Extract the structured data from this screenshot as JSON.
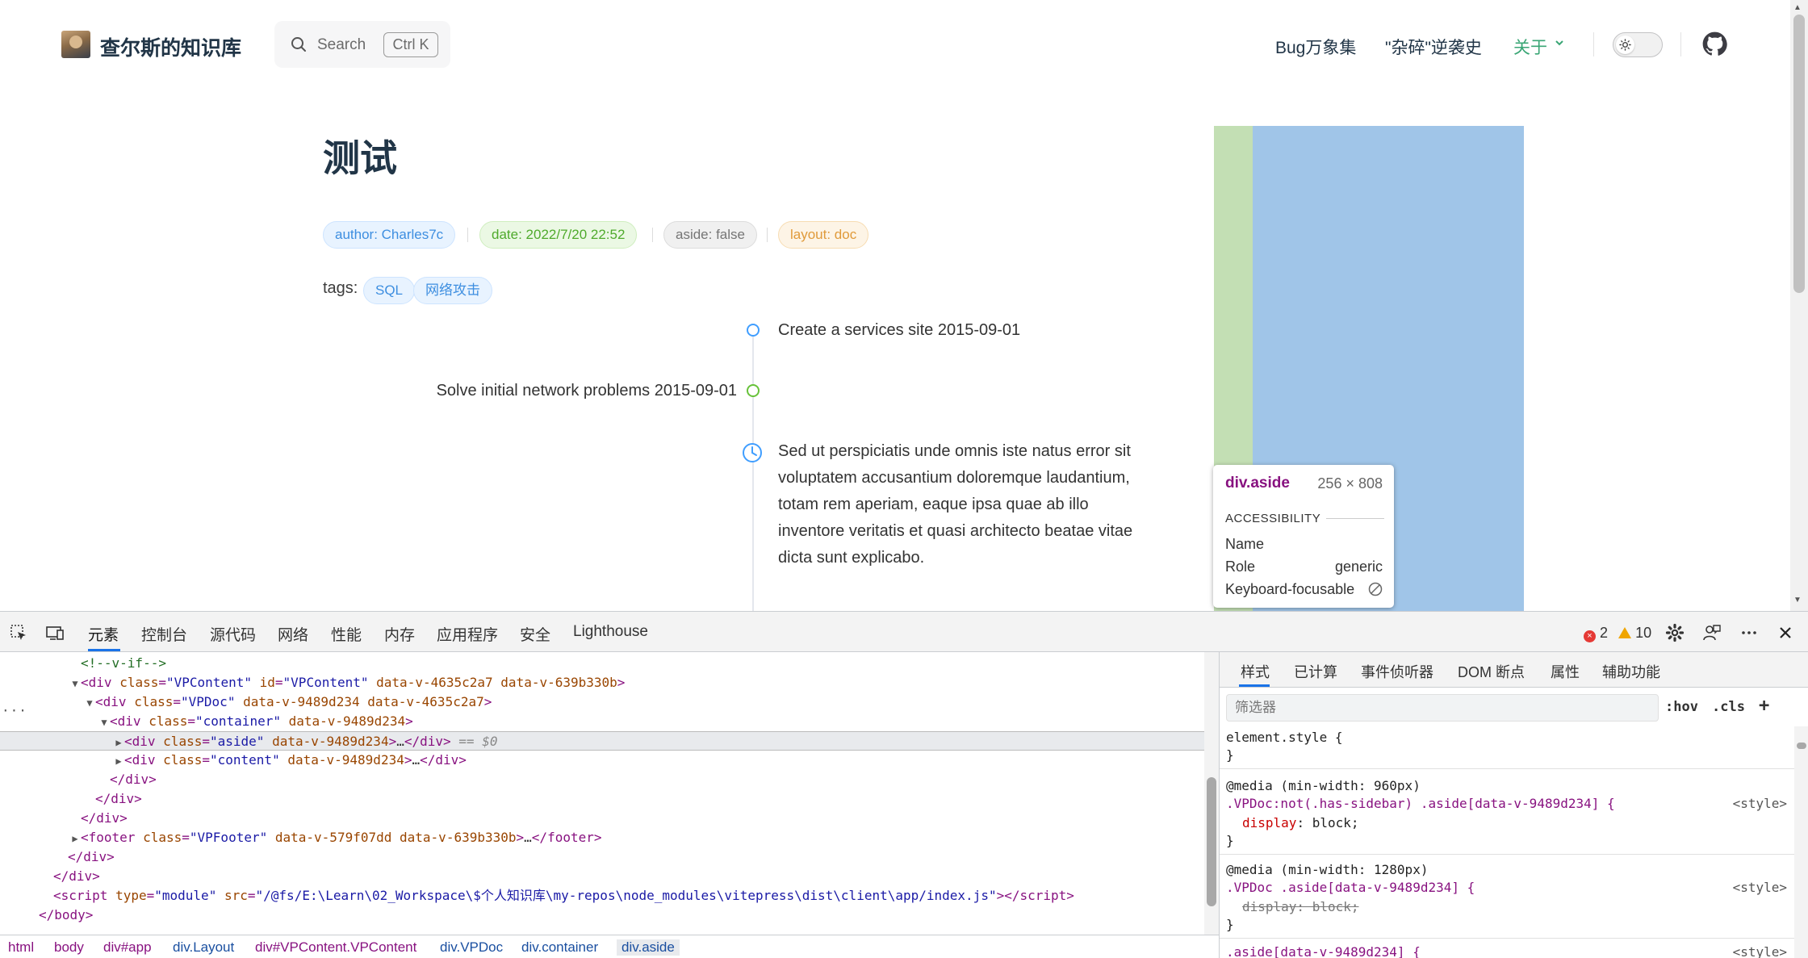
{
  "nav": {
    "site_title": "查尔斯的知识库",
    "search_label": "Search",
    "search_kbd": "Ctrl K",
    "links": [
      {
        "label": "Bug万象集"
      },
      {
        "label": "\"杂碎\"逆袭史"
      },
      {
        "label": "关于"
      }
    ]
  },
  "doc": {
    "title": "测试",
    "badges": {
      "author": "author: Charles7c",
      "date": "date: 2022/7/20 22:52",
      "aside": "aside: false",
      "layout": "layout: doc"
    },
    "tags_label": "tags:",
    "tags": [
      "SQL",
      "网络攻击"
    ],
    "timeline": [
      {
        "text": "Create a services site 2015-09-01"
      },
      {
        "text": "Solve initial network problems 2015-09-01"
      },
      {
        "lines": [
          "Sed ut perspiciatis unde omnis iste natus error sit",
          "voluptatem accusantium doloremque laudantium,",
          "totam rem aperiam, eaque ipsa quae ab illo",
          "inventore veritatis et quasi architecto beatae vitae",
          "dicta sunt explicabo."
        ]
      }
    ]
  },
  "tooltip": {
    "element": "div.aside",
    "size": "256 × 808",
    "section": "ACCESSIBILITY",
    "rows": {
      "name_label": "Name",
      "role_label": "Role",
      "role_value": "generic",
      "focus_label": "Keyboard-focusable"
    }
  },
  "devtools": {
    "tabs": [
      "元素",
      "控制台",
      "源代码",
      "网络",
      "性能",
      "内存",
      "应用程序",
      "安全",
      "Lighthouse"
    ],
    "errors": "2",
    "warnings": "10",
    "style_tabs": [
      "样式",
      "已计算",
      "事件侦听器",
      "DOM 断点",
      "属性",
      "辅助功能"
    ],
    "filter_placeholder": "筛选器",
    "hov": ":hov",
    "cls": ".cls",
    "plus": "+",
    "breadcrumb": [
      "html",
      "body",
      "div#app",
      "div.Layout",
      "div#VPContent.VPContent",
      "div.VPDoc",
      "div.container",
      "div.aside"
    ],
    "elements": {
      "l0": "<!--v-if-->",
      "l1_tag": "div",
      "l1_class": "VPContent",
      "l1_id": "VPContent",
      "l1_a1": "data-v-4635c2a7",
      "l1_a2": "data-v-639b330b",
      "l2_tag": "div",
      "l2_class": "VPDoc",
      "l2_a1": "data-v-9489d234",
      "l2_a2": "data-v-4635c2a7",
      "l3_tag": "div",
      "l3_class": "container",
      "l3_a1": "data-v-9489d234",
      "l4_class": "aside",
      "l4_a1": "data-v-9489d234",
      "l4_sel": "== $0",
      "l5_class": "content",
      "l5_a1": "data-v-9489d234",
      "l6": "</div>",
      "l7": "</div>",
      "l8": "</div>",
      "l9_tag": "footer",
      "l9_class": "VPFooter",
      "l9_a1": "data-v-579f07dd",
      "l9_a2": "data-v-639b330b",
      "l10": "</div>",
      "l11": "</div>",
      "l12_type": "module",
      "l12_src": "/@fs/E:\\Learn\\02_Workspace\\$个人知识库\\my-repos\\node_modules\\vitepress\\dist\\client\\app/index.js",
      "l13": "</body>"
    },
    "styles": {
      "element_style": "element.style {",
      "close": "}",
      "media1": "@media (min-width: 960px)",
      "rule1_sel": ".VPDoc:not(.has-sidebar) .aside[data-v-9489d234] {",
      "rule1_prop": "display",
      "rule1_val": "block;",
      "media2": "@media (min-width: 1280px)",
      "rule2_sel": ".VPDoc .aside[data-v-9489d234] {",
      "rule2_decl": "display: block;",
      "rule3_sel": ".aside[data-v-9489d234] {",
      "src": "<style>"
    }
  },
  "colors": {
    "brand": "#3aa675",
    "badge_blue": "#3d8ee0",
    "badge_green": "#4faa2c",
    "badge_orange": "#e09a3a",
    "timeline_blue": "#409eff",
    "timeline_green": "#67c23a",
    "aside_margin": "#c3dfb4",
    "aside_content": "#a0c5e8"
  }
}
